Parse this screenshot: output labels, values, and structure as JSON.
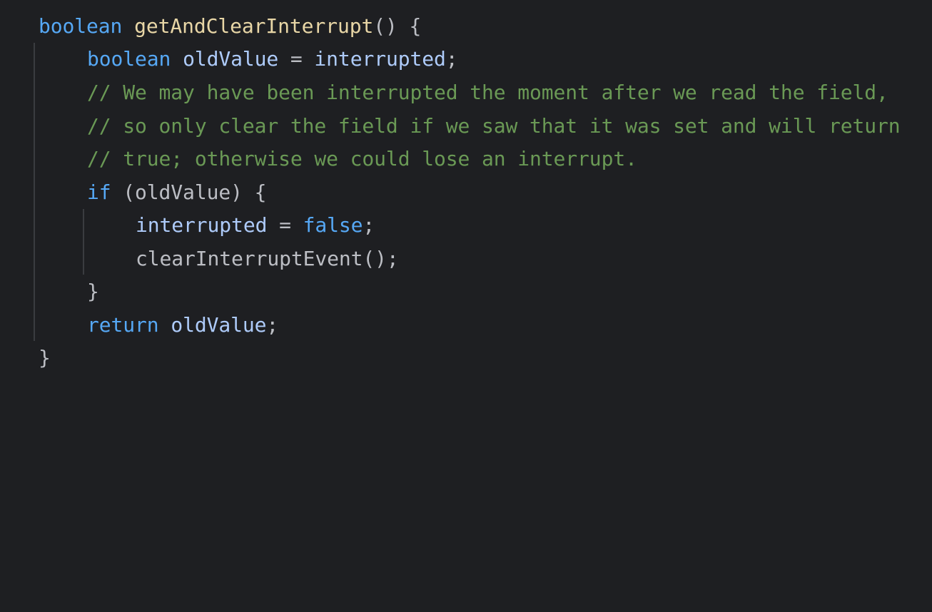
{
  "code": {
    "line1": {
      "kw": "boolean",
      "fn": "getAndClearInterrupt",
      "rest": "() {"
    },
    "line2": {
      "kw": "boolean",
      "var": "oldValue",
      "eq": " = ",
      "field": "interrupted",
      "semi": ";"
    },
    "line3": {
      "comment": "// We may have been interrupted the moment after we read the field,"
    },
    "line4": {
      "comment": "// so only clear the field if we saw that it was set and will return"
    },
    "line5": {
      "comment": "// true; otherwise we could lose an interrupt."
    },
    "line6": {
      "kw": "if",
      "rest": " (oldValue) {"
    },
    "line7": {
      "field": "interrupted",
      "eq": " = ",
      "lit": "false",
      "semi": ";"
    },
    "line8": {
      "call": "clearInterruptEvent();"
    },
    "line9": {
      "brace": "}"
    },
    "line10": {
      "kw": "return",
      "var": "oldValue",
      "semi": ";"
    },
    "line11": {
      "brace": "}"
    }
  },
  "colors": {
    "background": "#1e1f22",
    "keyword": "#56a8f5",
    "function_name": "#e8d6a6",
    "comment": "#6a9955",
    "default_text": "#bcbec4"
  }
}
